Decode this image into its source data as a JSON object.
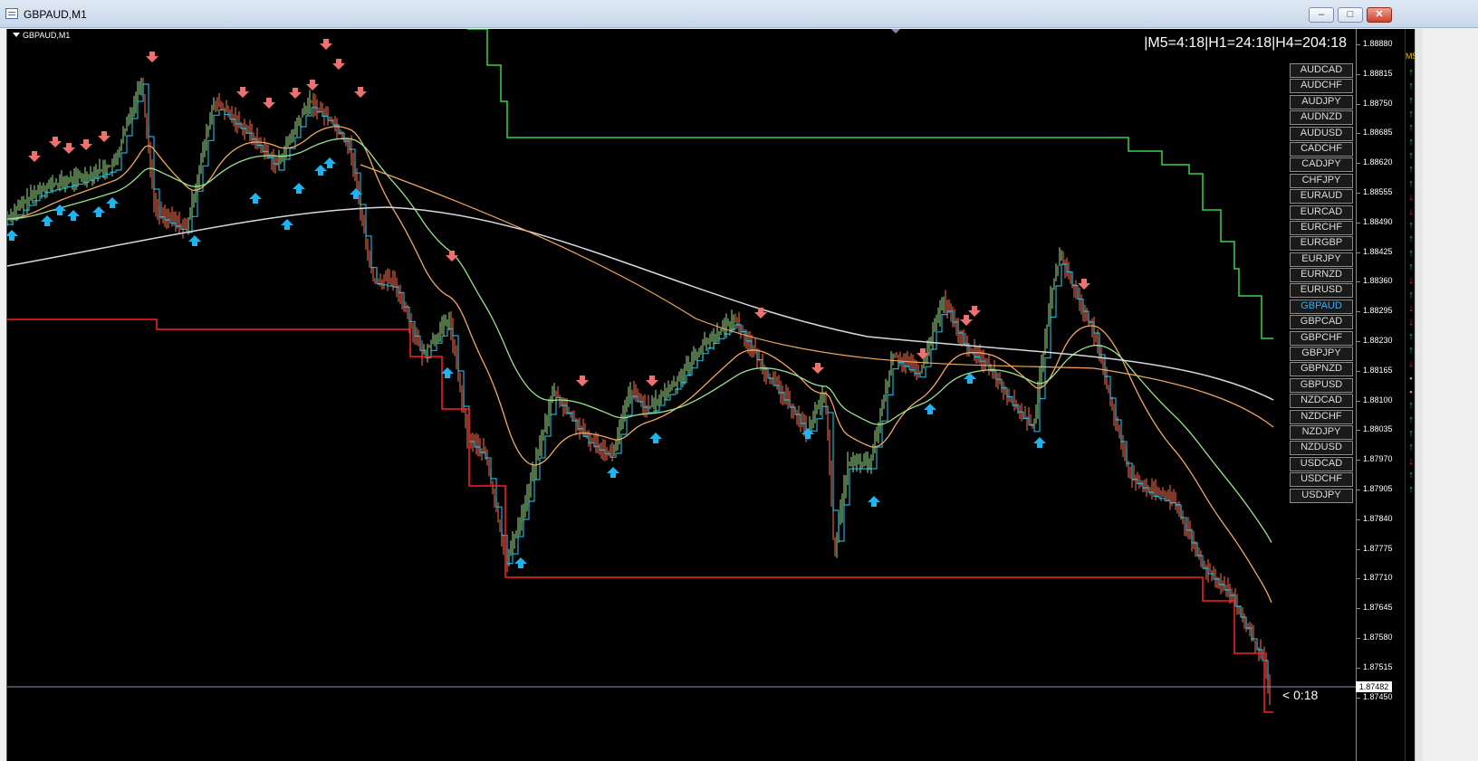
{
  "window": {
    "title": "GBPAUD,M1"
  },
  "window_buttons": {
    "minimize": "–",
    "maximize": "□",
    "close": "✕"
  },
  "chart": {
    "label": "GBPAUD,M1",
    "timer_text": "|M5=4:18|H1=24:18|H4=204:18",
    "countdown": "< 0:18",
    "current_price": "1.87482",
    "price_labels": [
      "1.88880",
      "1.88815",
      "1.88750",
      "1.88685",
      "1.88620",
      "1.88555",
      "1.88490",
      "1.88425",
      "1.88360",
      "1.88295",
      "1.88230",
      "1.88165",
      "1.88100",
      "1.88035",
      "1.87970",
      "1.87905",
      "1.87840",
      "1.87775",
      "1.87710",
      "1.87645",
      "1.87580",
      "1.87515",
      "1.87450"
    ]
  },
  "symbols": [
    "AUDCAD",
    "AUDCHF",
    "AUDJPY",
    "AUDNZD",
    "AUDUSD",
    "CADCHF",
    "CADJPY",
    "CHFJPY",
    "EURAUD",
    "EURCAD",
    "EURCHF",
    "EURGBP",
    "EURJPY",
    "EURNZD",
    "EURUSD",
    "GBPAUD",
    "GBPCAD",
    "GBPCHF",
    "GBPJPY",
    "GBPNZD",
    "GBPUSD",
    "NZDCAD",
    "NZDCHF",
    "NZDJPY",
    "NZDUSD",
    "USDCAD",
    "USDCHF",
    "USDJPY"
  ],
  "active_symbol": "GBPAUD",
  "strip": {
    "timeframe": "M5",
    "arrows": [
      "up",
      "up",
      "up",
      "up",
      "up",
      "up",
      "up",
      "up",
      "up",
      "down",
      "down",
      "up",
      "up",
      "up",
      "up",
      "down",
      "up",
      "down",
      "down",
      "up",
      "up",
      "down",
      "dot",
      "dot",
      "up",
      "up",
      "up",
      "up",
      "down",
      "up",
      "up"
    ]
  },
  "colors": {
    "up_marker": "#1eb4f0",
    "down_marker": "#f07070",
    "active_symbol": "#2fb0ff",
    "bear_candle": "#ff7050",
    "bull_candle": "#9be28c"
  }
}
